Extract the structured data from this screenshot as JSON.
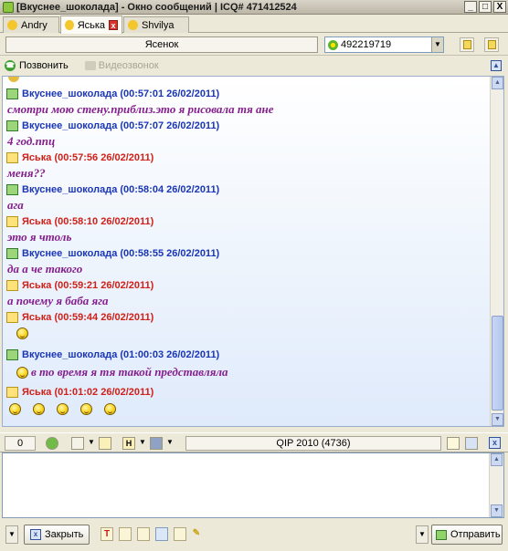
{
  "window": {
    "title": "[Вкуснее_шоколада] - Окно сообщений | ICQ# 471412524",
    "buttons": [
      "_",
      "□",
      "X"
    ]
  },
  "tabs": [
    {
      "label": "Andry",
      "active": false
    },
    {
      "label": "Яська",
      "active": true
    },
    {
      "label": "Shvilya",
      "active": false
    }
  ],
  "contact": {
    "name": "Ясенок",
    "uin": "492219719"
  },
  "callbar": {
    "call_label": "Позвонить",
    "video_label": "Видеозвонок"
  },
  "messages": [
    {
      "from": "them",
      "header": "Вкуснее_шоколада (00:57:01 26/02/2011)",
      "text": "смотри мою стену.приблиз.это я рисовала тя ане"
    },
    {
      "from": "them",
      "header": "Вкуснее_шоколада (00:57:07 26/02/2011)",
      "text": "4 год.ппц"
    },
    {
      "from": "me",
      "header": "Яська (00:57:56 26/02/2011)",
      "text": "меня??"
    },
    {
      "from": "them",
      "header": "Вкуснее_шоколада (00:58:04 26/02/2011)",
      "text": "ага"
    },
    {
      "from": "me",
      "header": "Яська (00:58:10 26/02/2011)",
      "text": "это я чтоль"
    },
    {
      "from": "them",
      "header": "Вкуснее_шоколада (00:58:55 26/02/2011)",
      "text": "да а че такого"
    },
    {
      "from": "me",
      "header": "Яська (00:59:21 26/02/2011)",
      "text": "а почему я баба яга"
    },
    {
      "from": "me",
      "header": "Яська (00:59:44 26/02/2011)",
      "text": ""
    },
    {
      "from": "them",
      "header": "Вкуснее_шоколада (01:00:03 26/02/2011)",
      "text": "в то время я тя такой представляла"
    },
    {
      "from": "me",
      "header": "Яська (01:01:02 26/02/2011)",
      "text": ""
    }
  ],
  "midbar": {
    "counter": "0",
    "status": "QIP 2010 (4736)",
    "tool_h": "H"
  },
  "input": {
    "value": ""
  },
  "bottombar": {
    "close_label": "Закрыть",
    "send_label": "Отправить",
    "tool_t": "T"
  },
  "colors": {
    "them": "#1a36b6",
    "me": "#d02018",
    "message_text": "#851f8d"
  }
}
